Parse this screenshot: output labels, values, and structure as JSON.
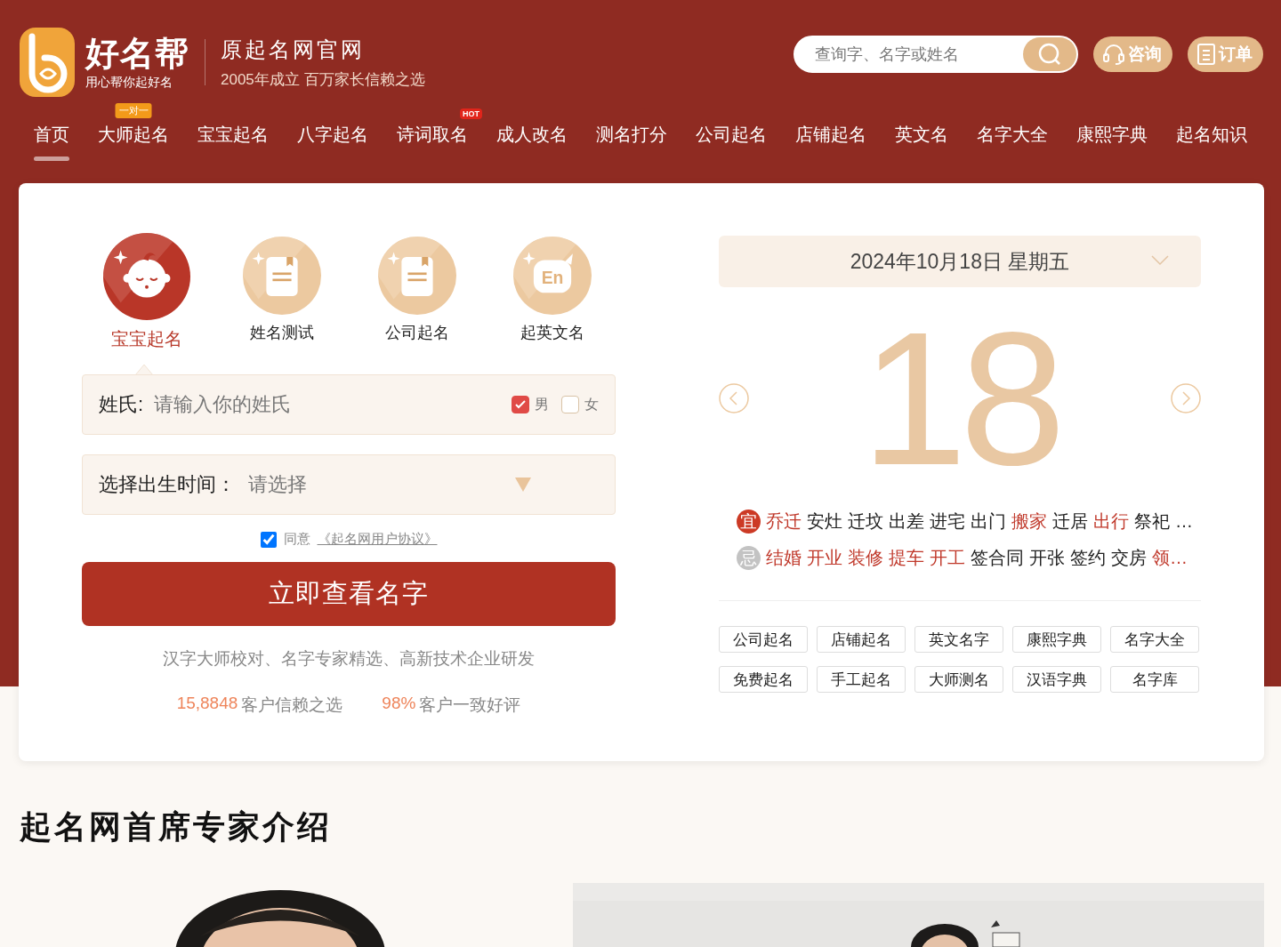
{
  "header": {
    "brand": "好名帮",
    "slogan": "用心帮你起好名",
    "site_title": "原起名网官网",
    "site_subtitle": "2005年成立 百万家长信赖之选",
    "search": {
      "placeholder": "查询字、名字或姓名"
    },
    "buttons": [
      {
        "kind": "consult",
        "label": "咨询"
      },
      {
        "kind": "order",
        "label": "订单"
      }
    ]
  },
  "nav": [
    {
      "label": "首页",
      "selected": true
    },
    {
      "label": "大师起名",
      "selected": false,
      "badge": {
        "kind": "tip",
        "text": "一对一"
      }
    },
    {
      "label": "宝宝起名",
      "selected": false
    },
    {
      "label": "八字起名",
      "selected": false
    },
    {
      "label": "诗词取名",
      "selected": false,
      "badge": {
        "kind": "hot",
        "text": "HOT"
      }
    },
    {
      "label": "成人改名",
      "selected": false
    },
    {
      "label": "测名打分",
      "selected": false
    },
    {
      "label": "公司起名",
      "selected": false
    },
    {
      "label": "店铺起名",
      "selected": false
    },
    {
      "label": "英文名",
      "selected": false
    },
    {
      "label": "名字大全",
      "selected": false
    },
    {
      "label": "康熙字典",
      "selected": false
    },
    {
      "label": "起名知识",
      "selected": false
    }
  ],
  "naming_tabs": [
    {
      "label": "宝宝起名",
      "kind": "baby",
      "selected": true
    },
    {
      "label": "姓名测试",
      "kind": "book",
      "selected": false
    },
    {
      "label": "公司起名",
      "kind": "book",
      "selected": false
    },
    {
      "label": "起英文名",
      "kind": "english",
      "glyph": "En",
      "selected": false
    }
  ],
  "surname_field": {
    "label": "姓氏:",
    "placeholder": "请输入你的姓氏",
    "genders": [
      {
        "label": "男",
        "checked": true
      },
      {
        "label": "女",
        "checked": false
      }
    ]
  },
  "birth_field": {
    "label": "选择出生时间：",
    "placeholder": "请选择"
  },
  "agreement": {
    "checked": true,
    "text": "同意",
    "link": "《起名网用户协议》"
  },
  "submit": "立即查看名字",
  "tagline": "汉字大师校对、名字专家精选、高新技术企业研发",
  "stats": [
    {
      "value": "15,8848",
      "label": "客户信赖之选"
    },
    {
      "value": "98%",
      "label": "客户一致好评"
    }
  ],
  "calendar": {
    "date": "2024年10月18日 星期五",
    "day": "18",
    "almanac": [
      {
        "kind": "yi",
        "mark": "宜",
        "more": "…",
        "items": [
          {
            "text": "乔迁",
            "highlighted": true
          },
          {
            "text": "安灶",
            "highlighted": false
          },
          {
            "text": "迁坟",
            "highlighted": false
          },
          {
            "text": "出差",
            "highlighted": false
          },
          {
            "text": "进宅",
            "highlighted": false
          },
          {
            "text": "出门",
            "highlighted": false
          },
          {
            "text": "搬家",
            "highlighted": true
          },
          {
            "text": "迁居",
            "highlighted": false
          },
          {
            "text": "出行",
            "highlighted": true
          },
          {
            "text": "祭祀",
            "highlighted": false
          }
        ]
      },
      {
        "kind": "ji",
        "mark": "忌",
        "items": [
          {
            "text": "结婚",
            "highlighted": true
          },
          {
            "text": "开业",
            "highlighted": true
          },
          {
            "text": "装修",
            "highlighted": true
          },
          {
            "text": "提车",
            "highlighted": true
          },
          {
            "text": "开工",
            "highlighted": true
          },
          {
            "text": "签合同",
            "highlighted": false
          },
          {
            "text": "开张",
            "highlighted": false
          },
          {
            "text": "签约",
            "highlighted": false
          },
          {
            "text": "交房",
            "highlighted": false
          },
          {
            "text": "领…",
            "highlighted": true
          }
        ]
      }
    ],
    "links": [
      "公司起名",
      "店铺起名",
      "英文名字",
      "康熙字典",
      "名字大全",
      "免费起名",
      "手工起名",
      "大师测名",
      "汉语字典",
      "名字库"
    ]
  },
  "experts": {
    "heading": "起名网首席专家介绍"
  }
}
